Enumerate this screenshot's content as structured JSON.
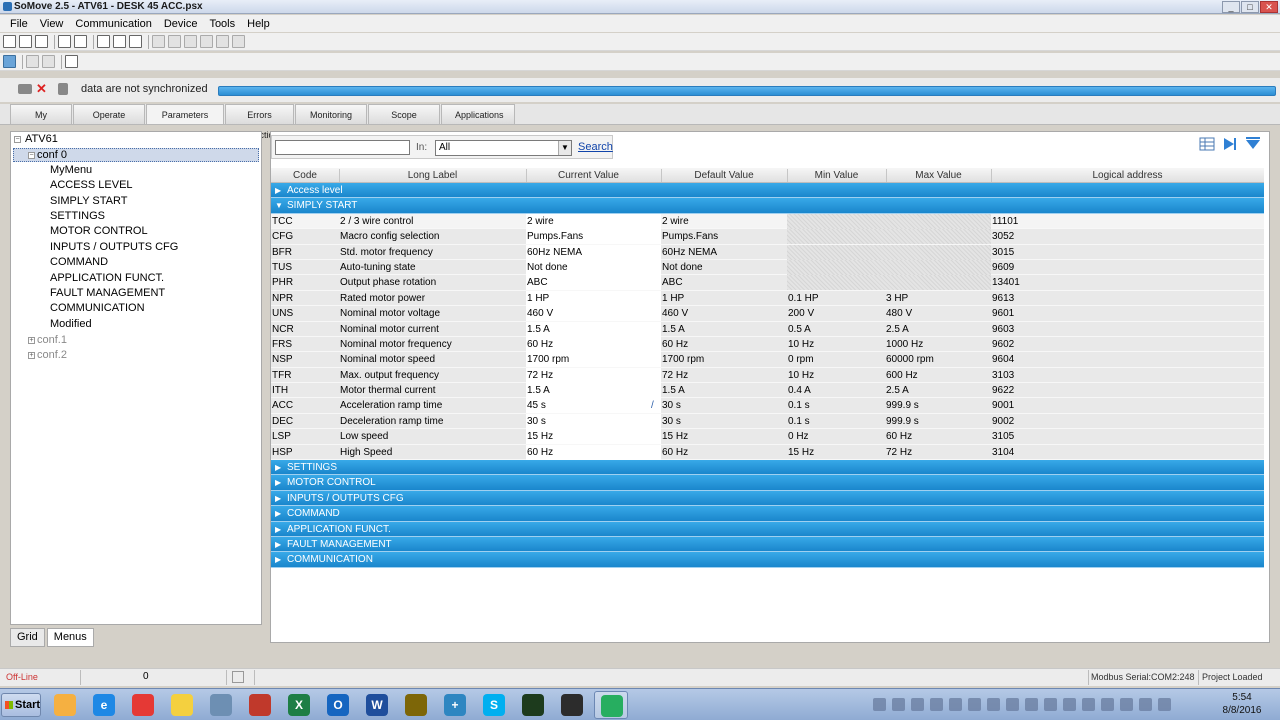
{
  "window": {
    "title": "SoMove 2.5 - ATV61 - DESK 45 ACC.psx",
    "controls": [
      "_",
      "□",
      "✕"
    ]
  },
  "menu": [
    "File",
    "View",
    "Communication",
    "Device",
    "Tools",
    "Help"
  ],
  "sync": {
    "message": "data are not synchronized",
    "disconnect_glyph": "✕",
    "progress": 1.0
  },
  "tabs": [
    "My Device",
    "Operate",
    "Parameters",
    "Errors Detection",
    "Monitoring",
    "Scope",
    "Applications"
  ],
  "active_tab": "Parameters",
  "tree": {
    "root": "ATV61",
    "expand_glyph": "−",
    "collapsed_glyph": "+",
    "selected": "conf 0",
    "children": [
      "MyMenu",
      "ACCESS LEVEL",
      "SIMPLY START",
      "SETTINGS",
      "MOTOR CONTROL",
      "INPUTS / OUTPUTS CFG",
      "COMMAND",
      "APPLICATION FUNCT.",
      "FAULT MANAGEMENT",
      "COMMUNICATION",
      "Modified"
    ],
    "others": [
      "conf.1",
      "conf.2"
    ]
  },
  "bottom_tabs": [
    "Grid",
    "Menus"
  ],
  "search": {
    "value": "",
    "in_label": "In:",
    "scope": "All",
    "scope_arrow": "▼",
    "button": "Search"
  },
  "grid": {
    "columns": [
      "Code",
      "Long Label",
      "Current Value",
      "Default Value",
      "Min Value",
      "Max Value",
      "Logical address"
    ],
    "collapsed_glyph": "▶",
    "expanded_glyph": "▼",
    "edit_glyph": "/",
    "sections_before": [
      "Access level"
    ],
    "open_section": "SIMPLY START",
    "rows": [
      {
        "code": "TCC",
        "label": "2 / 3 wire control",
        "current": "2 wire",
        "default": "2 wire",
        "min": "",
        "max": "",
        "addr": "11101",
        "hatched": true
      },
      {
        "code": "CFG",
        "label": "Macro config selection",
        "current": "Pumps.Fans",
        "default": "Pumps.Fans",
        "min": "",
        "max": "",
        "addr": "3052",
        "hatched": true
      },
      {
        "code": "BFR",
        "label": "Std. motor frequency",
        "current": "60Hz NEMA",
        "default": "60Hz NEMA",
        "min": "",
        "max": "",
        "addr": "3015",
        "hatched": true
      },
      {
        "code": "TUS",
        "label": "Auto-tuning state",
        "current": "Not done",
        "default": "Not done",
        "min": "",
        "max": "",
        "addr": "9609",
        "hatched": true
      },
      {
        "code": "PHR",
        "label": "Output phase rotation",
        "current": "ABC",
        "default": "ABC",
        "min": "",
        "max": "",
        "addr": "13401",
        "hatched": true
      },
      {
        "code": "NPR",
        "label": "Rated motor power",
        "current": "1 HP",
        "default": "1 HP",
        "min": "0.1 HP",
        "max": "3 HP",
        "addr": "9613"
      },
      {
        "code": "UNS",
        "label": "Nominal motor voltage",
        "current": "460 V",
        "default": "460 V",
        "min": "200 V",
        "max": "480 V",
        "addr": "9601"
      },
      {
        "code": "NCR",
        "label": "Nominal motor current",
        "current": "1.5 A",
        "default": "1.5 A",
        "min": "0.5 A",
        "max": "2.5 A",
        "addr": "9603"
      },
      {
        "code": "FRS",
        "label": "Nominal motor frequency",
        "current": "60 Hz",
        "default": "60 Hz",
        "min": "10 Hz",
        "max": "1000 Hz",
        "addr": "9602"
      },
      {
        "code": "NSP",
        "label": "Nominal motor speed",
        "current": "1700 rpm",
        "default": "1700 rpm",
        "min": "0 rpm",
        "max": "60000 rpm",
        "addr": "9604"
      },
      {
        "code": "TFR",
        "label": "Max. output frequency",
        "current": "72 Hz",
        "default": "72 Hz",
        "min": "10 Hz",
        "max": "600 Hz",
        "addr": "3103"
      },
      {
        "code": "ITH",
        "label": "Motor thermal current",
        "current": "1.5 A",
        "default": "1.5 A",
        "min": "0.4 A",
        "max": "2.5 A",
        "addr": "9622"
      },
      {
        "code": "ACC",
        "label": "Acceleration ramp time",
        "current": "45 s",
        "default": "30 s",
        "min": "0.1 s",
        "max": "999.9 s",
        "addr": "9001",
        "edited": true
      },
      {
        "code": "DEC",
        "label": "Deceleration ramp time",
        "current": "30 s",
        "default": "30 s",
        "min": "0.1 s",
        "max": "999.9 s",
        "addr": "9002"
      },
      {
        "code": "LSP",
        "label": "Low speed",
        "current": "15 Hz",
        "default": "15 Hz",
        "min": "0 Hz",
        "max": "60 Hz",
        "addr": "3105"
      },
      {
        "code": "HSP",
        "label": "High Speed",
        "current": "60 Hz",
        "default": "60 Hz",
        "min": "15 Hz",
        "max": "72 Hz",
        "addr": "3104"
      }
    ],
    "sections_after": [
      "SETTINGS",
      "MOTOR CONTROL",
      "INPUTS / OUTPUTS CFG",
      "COMMAND",
      "APPLICATION FUNCT.",
      "FAULT MANAGEMENT",
      "COMMUNICATION"
    ]
  },
  "status": {
    "connection": "Off-Line",
    "counter": "0",
    "port": "Modbus Serial:COM2:248",
    "project": "Project Loaded"
  },
  "taskbar": {
    "start": "Start",
    "apps": [
      {
        "name": "folder-icon",
        "color": "#f5b041",
        "glyph": ""
      },
      {
        "name": "ie-icon",
        "color": "#1e88e5",
        "glyph": "e"
      },
      {
        "name": "chrome-icon",
        "color": "#e53935",
        "glyph": ""
      },
      {
        "name": "explorer-icon",
        "color": "#f4d03f",
        "glyph": ""
      },
      {
        "name": "somove-app-icon",
        "color": "#6d8fb3",
        "glyph": ""
      },
      {
        "name": "tool-icon",
        "color": "#c0392b",
        "glyph": ""
      },
      {
        "name": "excel-icon",
        "color": "#1e7e45",
        "glyph": "X"
      },
      {
        "name": "outlook-icon",
        "color": "#1565c0",
        "glyph": "O"
      },
      {
        "name": "word-icon",
        "color": "#1f4e9c",
        "glyph": "W"
      },
      {
        "name": "app-icon",
        "color": "#7d6608",
        "glyph": ""
      },
      {
        "name": "add-icon",
        "color": "#2e86c1",
        "glyph": "+"
      },
      {
        "name": "skype-icon",
        "color": "#00aff0",
        "glyph": "S"
      },
      {
        "name": "app-icon",
        "color": "#1d3b1d",
        "glyph": ""
      },
      {
        "name": "app-icon",
        "color": "#2c2c2c",
        "glyph": ""
      },
      {
        "name": "somove-active-icon",
        "color": "#27ae60",
        "glyph": "",
        "active": true
      }
    ],
    "time": "5:54",
    "date": "8/8/2016"
  }
}
